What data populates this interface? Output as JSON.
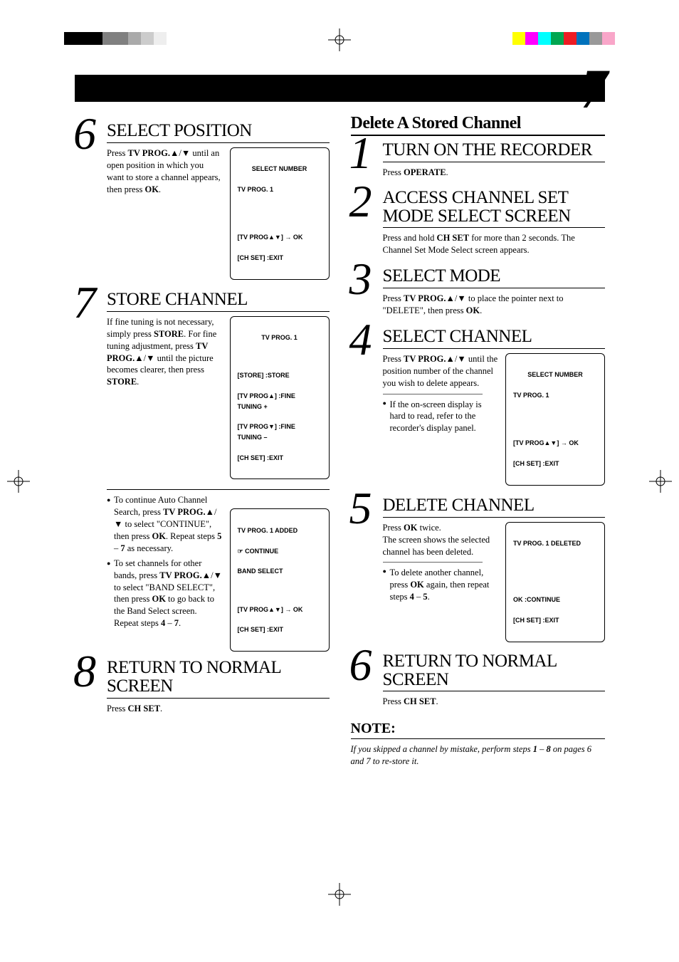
{
  "page_number": "7",
  "color_bar_left": [
    "#000",
    "#000",
    "#000",
    "#808080",
    "#808080",
    "#aaa",
    "#ccc",
    "#eee"
  ],
  "color_bar_right": [
    "#ffff00",
    "#ff00ff",
    "#00ffff",
    "#00a651",
    "#ed1c24",
    "#0072bc",
    "#999",
    "#f9a6c9"
  ],
  "left": {
    "s6": {
      "num": "6",
      "title": "SELECT POSITION",
      "body_pre": "Press ",
      "body_b1": "TV PROG.",
      "body_mid1": "▲/▼ until an open position in which you want to store a channel appears, then press ",
      "body_b2": "OK",
      "body_post": ".",
      "osd_l1": "SELECT NUMBER",
      "osd_l2": "TV PROG.    1",
      "osd_l3": "[TV PROG▲▼]  →  OK",
      "osd_l4": "[CH SET] :EXIT"
    },
    "s7": {
      "num": "7",
      "title": "STORE CHANNEL",
      "body": "If fine tuning is not necessary, simply press <b>STORE</b>. For fine tuning adjustment, press <b>TV PROG.</b>▲/▼ until the picture becomes clearer, then press <b>STORE</b>.",
      "osd_l1": "TV PROG.    1",
      "osd_l2": "[STORE] :STORE",
      "osd_l3": "[TV PROG▲] :FINE TUNING +",
      "osd_l4": "[TV PROG▼] :FINE TUNING –",
      "osd_l5": "[CH SET] :EXIT"
    },
    "notes": {
      "n1": "To continue Auto Channel Search, press <b>TV PROG.</b>▲/▼ to select \"CONTINUE\", then press <b>OK</b>. Repeat steps <b>5</b> – <b>7</b> as necessary.",
      "n2": "To set channels for other bands, press <b>TV PROG.</b>▲/▼ to select \"BAND SELECT\", then press <b>OK</b> to go back to the Band Select screen. Repeat steps <b>4</b> – <b>7</b>.",
      "osd_l1": "TV PROG.    1    ADDED",
      "osd_l2": "☞ CONTINUE",
      "osd_l3": "    BAND SELECT",
      "osd_l4": "[TV PROG▲▼]  →  OK",
      "osd_l5": "[CH SET] :EXIT"
    },
    "s8": {
      "num": "8",
      "title": "RETURN TO NORMAL SCREEN",
      "body": "Press <b>CH SET</b>."
    }
  },
  "right": {
    "heading": "Delete A Stored Channel",
    "s1": {
      "num": "1",
      "title": "TURN ON THE RECORDER",
      "body": "Press <b>OPERATE</b>."
    },
    "s2": {
      "num": "2",
      "title": "ACCESS CHANNEL SET MODE SELECT SCREEN",
      "body": "Press and hold <b>CH SET</b> for more than 2 seconds. The Channel Set Mode Select screen appears."
    },
    "s3": {
      "num": "3",
      "title": "SELECT MODE",
      "body": "Press <b>TV PROG.</b>▲/▼ to place the pointer next to \"DELETE\", then press <b>OK</b>."
    },
    "s4": {
      "num": "4",
      "title": "SELECT CHANNEL",
      "body": "Press <b>TV PROG.</b>▲/▼ until the position number of the channel you wish to delete appears.",
      "sub": "If the on-screen display is hard to read, refer to the recorder's display panel.",
      "osd_l1": "SELECT NUMBER",
      "osd_l2": "TV PROG.    1",
      "osd_l3": "[TV PROG▲▼]  →  OK",
      "osd_l4": "[CH SET] :EXIT"
    },
    "s5": {
      "num": "5",
      "title": "DELETE CHANNEL",
      "body": "Press <b>OK</b> twice.<br>The screen shows the selected channel has been deleted.",
      "sub": "To delete another channel, press <b>OK</b> again, then repeat steps <b>4</b> – <b>5</b>.",
      "osd_l1": "TV PROG.    1    DELETED",
      "osd_l2": "OK :CONTINUE",
      "osd_l3": "[CH SET] :EXIT"
    },
    "s6": {
      "num": "6",
      "title": "RETURN TO NORMAL SCREEN",
      "body": "Press <b>CH SET</b>."
    },
    "note_title": "NOTE:",
    "note_text": "If you skipped a channel by mistake, perform steps <b>1</b> – <b>8</b> on pages 6 and 7 to re-store it."
  }
}
